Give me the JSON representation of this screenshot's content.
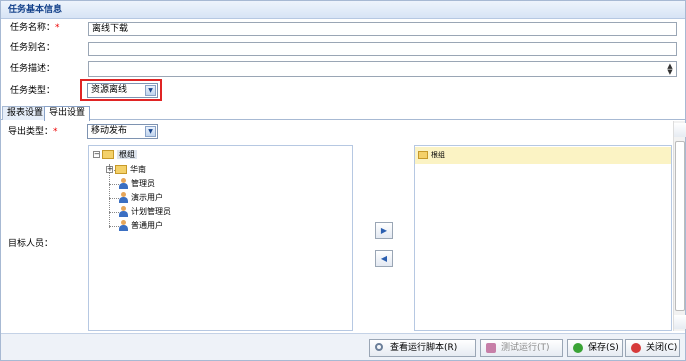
{
  "header": {
    "title": "任务基本信息"
  },
  "form": {
    "task_name": {
      "label": "任务名称：",
      "required_mark": "*",
      "value": "离线下载"
    },
    "task_alias": {
      "label": "任务别名：",
      "value": ""
    },
    "task_desc": {
      "label": "任务描述：",
      "value": ""
    },
    "task_type": {
      "label": "任务类型：",
      "value": "资源离线"
    }
  },
  "tabs": [
    {
      "label": "报表设置"
    },
    {
      "label": "导出设置"
    }
  ],
  "export": {
    "type": {
      "label": "导出类型：",
      "required_mark": "*",
      "value": "移动发布"
    },
    "target": {
      "label": "目标人员："
    }
  },
  "tree": {
    "root": "根组",
    "group": "华南",
    "users": [
      "管理员",
      "演示用户",
      "计划管理员",
      "普通用户"
    ]
  },
  "selected": {
    "items": [
      "根组"
    ]
  },
  "buttons": {
    "view_script": "查看运行脚本(R)",
    "test_run": "测试运行(T)",
    "save": "保存(S)",
    "close": "关闭(C)"
  },
  "colors": {
    "highlight": "#e02424",
    "selected_row": "#fbf3c4",
    "header_text": "#15428b"
  }
}
